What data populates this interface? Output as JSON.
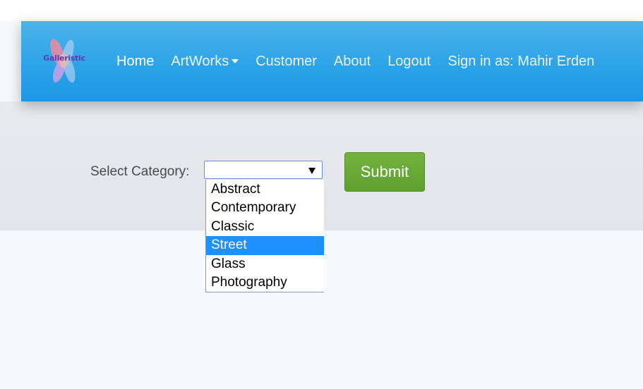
{
  "brand": {
    "logo_text": "Galleristic",
    "logo_icon": "flower-logo-icon",
    "colors": [
      "#f08aa0",
      "#9cc8f0",
      "#c8a0e8",
      "#f5b7a0"
    ]
  },
  "navbar": {
    "items": [
      {
        "label": "Home"
      },
      {
        "label": "ArtWorks",
        "has_caret": true
      },
      {
        "label": "Customer"
      },
      {
        "label": "About"
      },
      {
        "label": "Logout"
      },
      {
        "label": "Sign in as: Mahir Erden"
      }
    ]
  },
  "form": {
    "category_label": "Select Category:",
    "selected_value": "",
    "options": [
      "Abstract",
      "Contemporary",
      "Classic",
      "Street",
      "Glass",
      "Photography"
    ],
    "highlighted_option": "Street",
    "submit_label": "Submit"
  },
  "colors": {
    "navbar": "#2aa2e8",
    "submit": "#6aaa35",
    "highlight": "#1e90ff"
  }
}
